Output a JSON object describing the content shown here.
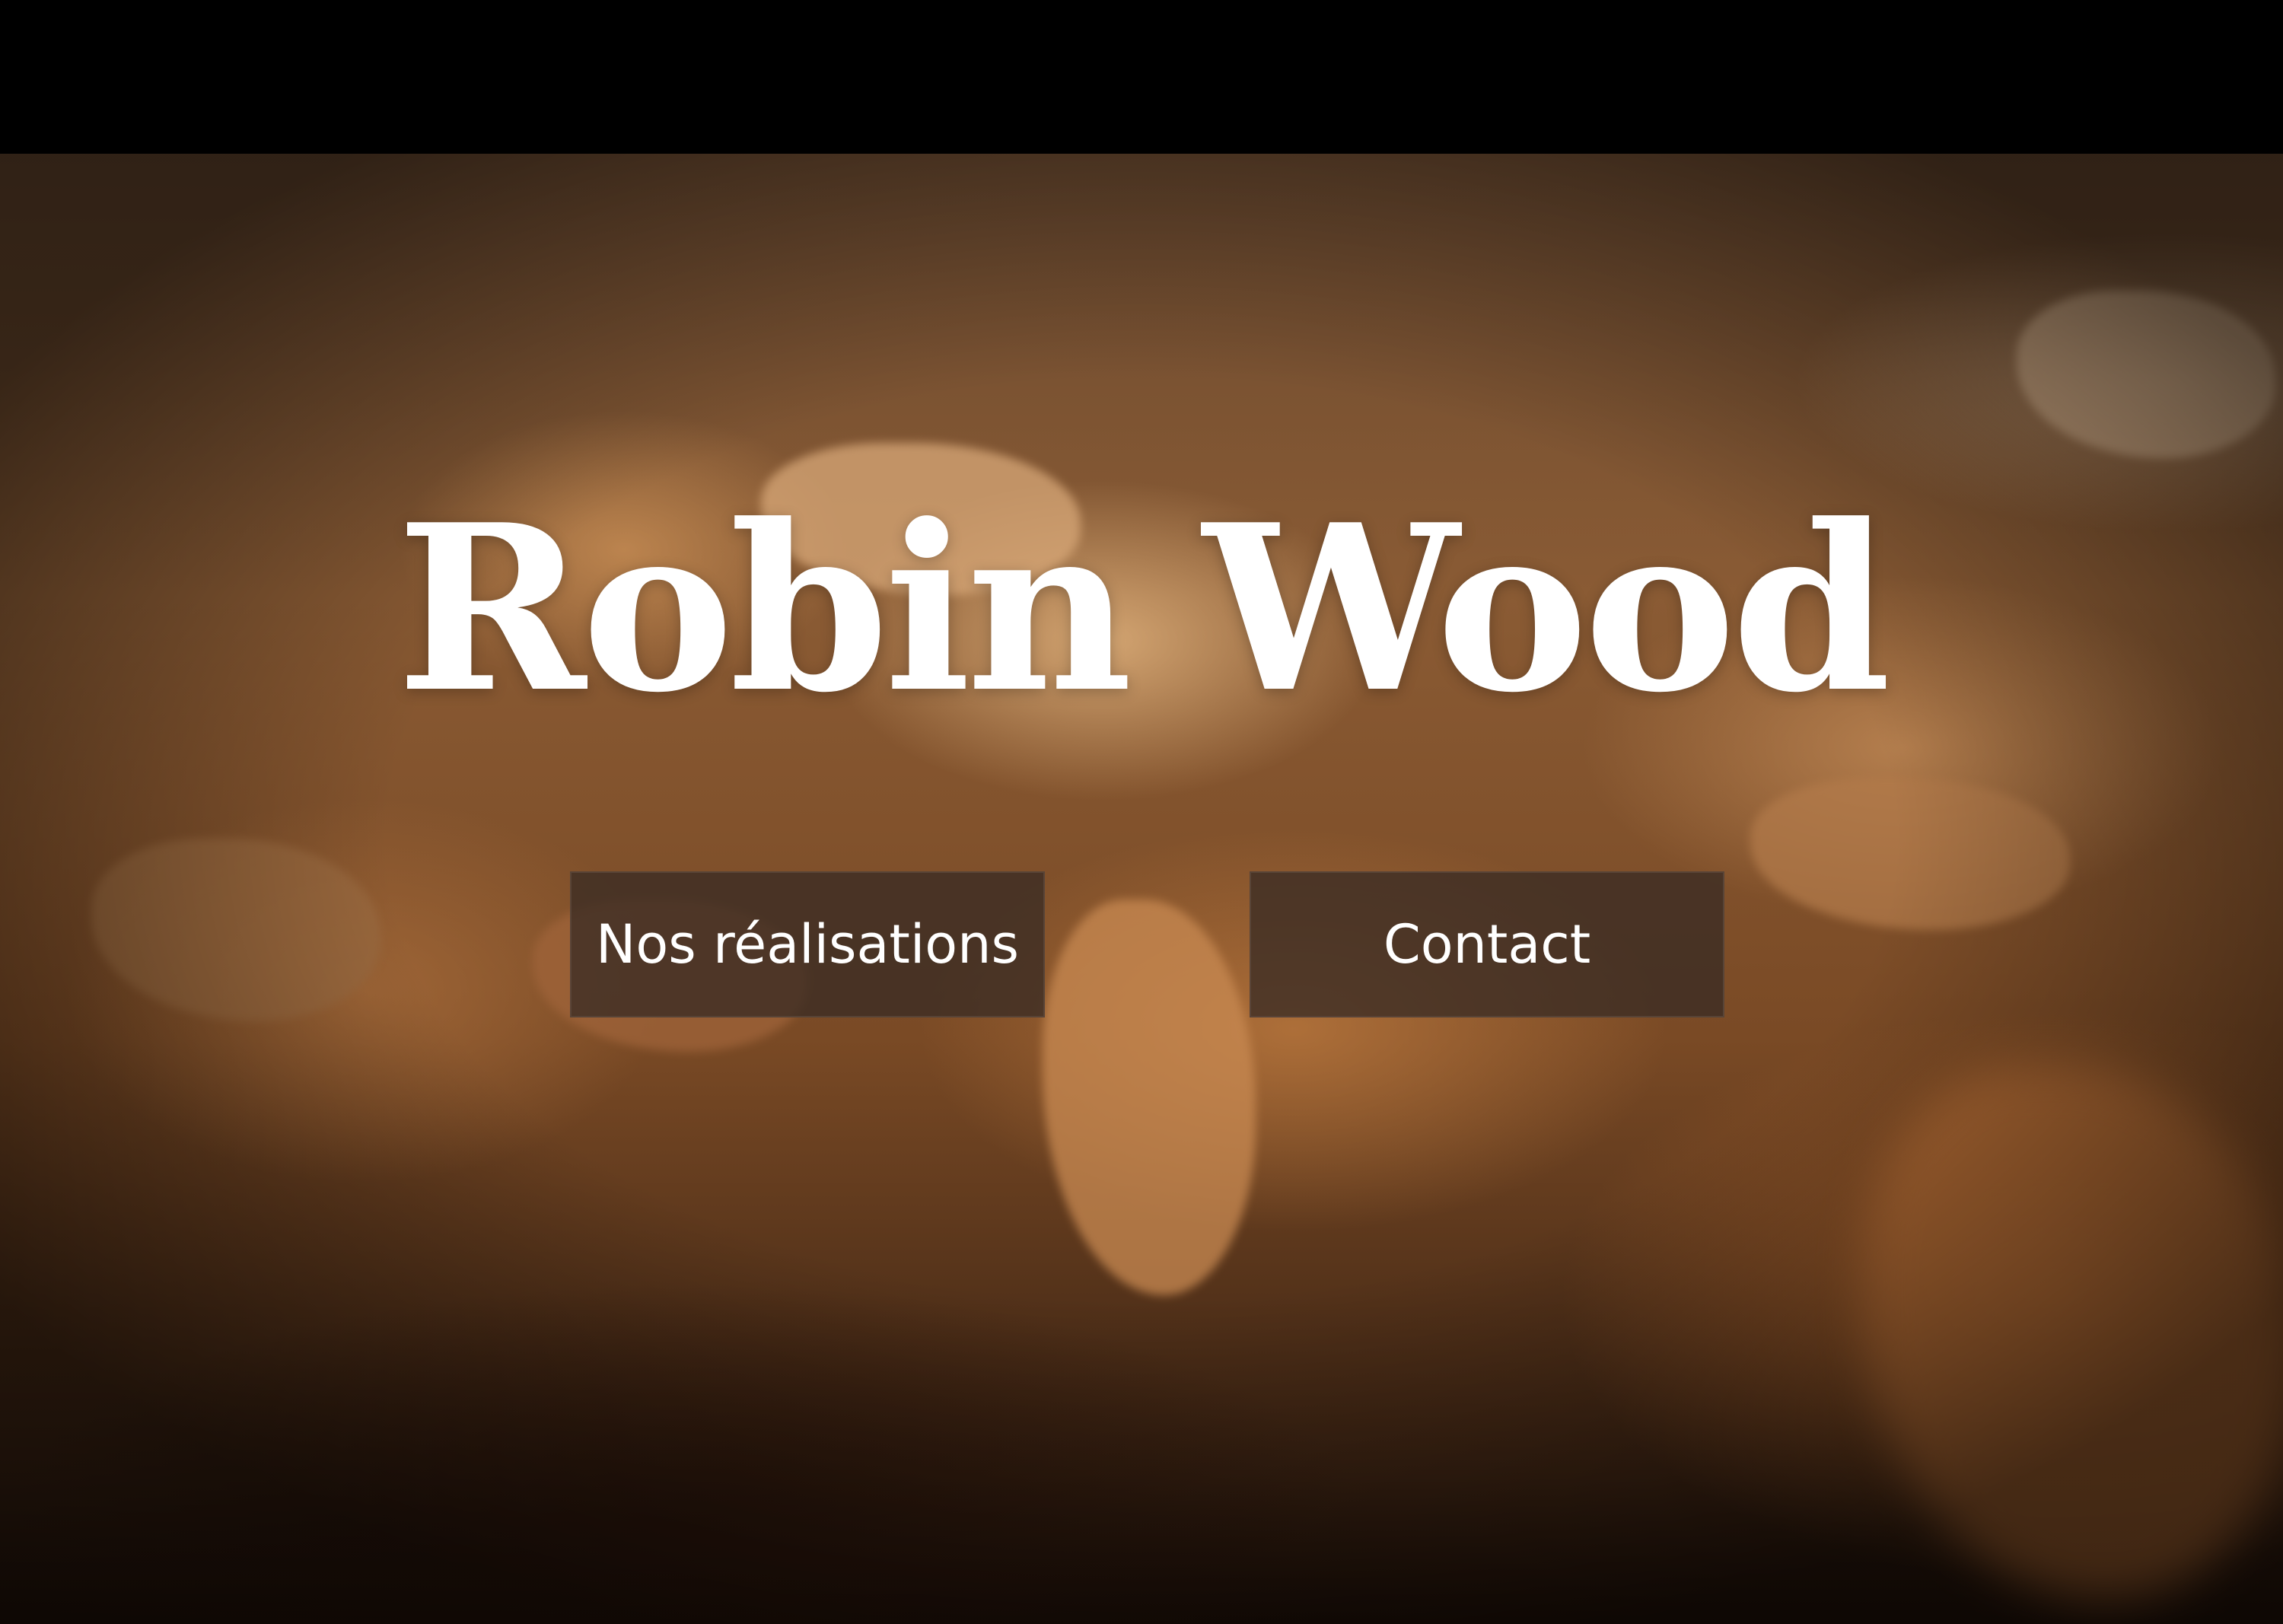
{
  "hero": {
    "title": "Robin Wood",
    "background_subject": "wood shavings",
    "colors": {
      "top_bar": "#000000",
      "button_bg": "#3a2c24",
      "text": "#ffffff"
    }
  },
  "buttons": {
    "realisations_label": "Nos réalisations",
    "contact_label": "Contact"
  }
}
